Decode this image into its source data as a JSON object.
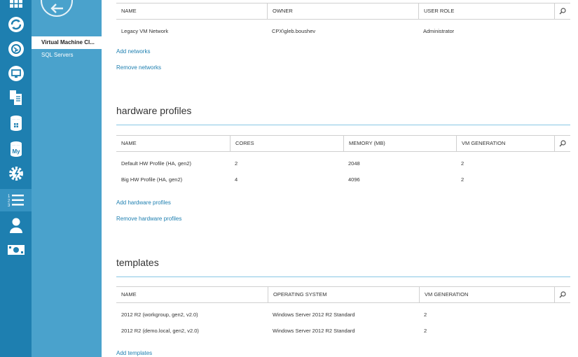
{
  "nav": {
    "items": [
      {
        "label": "Virtual Machine Cl...",
        "active": true
      },
      {
        "label": "SQL Servers",
        "active": false
      }
    ]
  },
  "networks": {
    "columns": [
      "NAME",
      "OWNER",
      "USER ROLE"
    ],
    "rows": [
      [
        "Legacy VM Network",
        "CPX\\gleb.boushev",
        "Administrator"
      ]
    ],
    "add_label": "Add networks",
    "remove_label": "Remove networks"
  },
  "hardware_profiles": {
    "title": "hardware profiles",
    "columns": [
      "NAME",
      "CORES",
      "MEMORY (MB)",
      "VM GENERATION"
    ],
    "rows": [
      [
        "Default HW Profile (HA, gen2)",
        "2",
        "2048",
        "2"
      ],
      [
        "Big HW Profile (HA, gen2)",
        "4",
        "4096",
        "2"
      ]
    ],
    "add_label": "Add hardware profiles",
    "remove_label": "Remove hardware profiles"
  },
  "templates": {
    "title": "templates",
    "columns": [
      "NAME",
      "OPERATING SYSTEM",
      "VM GENERATION"
    ],
    "rows": [
      [
        "2012 R2 (workgroup, gen2, v2.0)",
        "Windows Server 2012 R2 Standard",
        "2"
      ],
      [
        "2012 R2 (demo.local, gen2, v2.0)",
        "Windows Server 2012 R2 Standard",
        "2"
      ]
    ],
    "add_label": "Add templates"
  },
  "colors": {
    "rail": "#1e7fb0",
    "subnav": "#4aa2cc",
    "link": "#1e7fb0",
    "rule": "#88c7e4"
  }
}
